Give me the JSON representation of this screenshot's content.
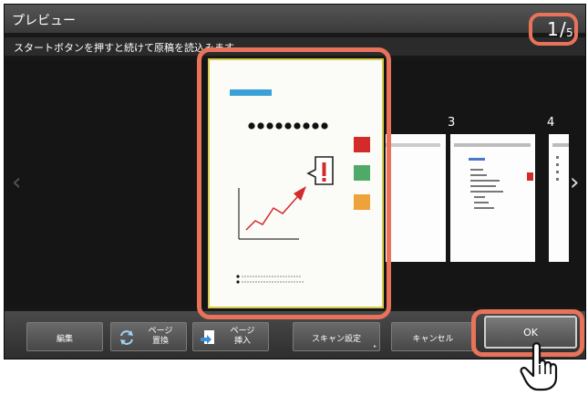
{
  "window": {
    "title": "プレビュー"
  },
  "message": "スタートボタンを押すと続けて原稿を読込みます。",
  "page_indicator": {
    "current": "1",
    "separator": "/",
    "total": "5"
  },
  "thumbnails": [
    {
      "number": "3"
    },
    {
      "number": "4"
    }
  ],
  "toolbar": {
    "edit_label": "編集",
    "page_replace_line1": "ページ",
    "page_replace_line2": "置換",
    "page_insert_line1": "ページ",
    "page_insert_line2": "挿入",
    "scan_settings_label": "スキャン設定",
    "cancel_label": "キャンセル",
    "ok_label": "OK"
  },
  "icons": {
    "left_nav": "chevron-left-icon",
    "right_nav": "chevron-right-icon",
    "replace": "page-replace-icon",
    "insert": "page-insert-icon",
    "pointer": "hand-pointer-icon"
  },
  "colors": {
    "highlight": "#e8735a",
    "selected_page_border": "#d8cc4a"
  }
}
